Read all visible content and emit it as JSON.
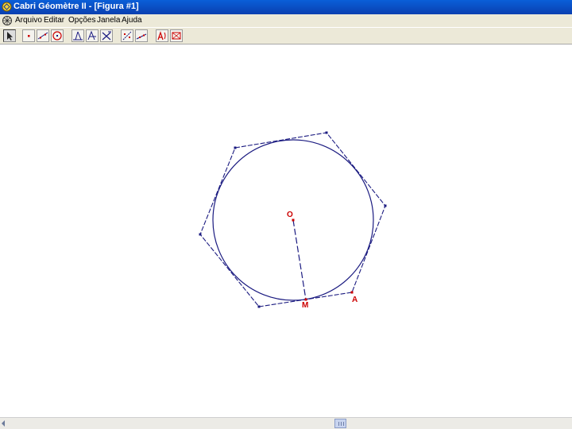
{
  "window": {
    "title": "Cabri Géomètre II - [Figura #1]",
    "icon": "cabri-app-icon"
  },
  "menu": {
    "items": [
      {
        "label": "Arquivo"
      },
      {
        "label": "Editar"
      },
      {
        "label": "Opções"
      },
      {
        "label": "Janela"
      },
      {
        "label": "Ajuda"
      }
    ]
  },
  "toolbar": {
    "tools": [
      {
        "name": "pointer-tool",
        "icon": "arrow-icon",
        "pressed": true
      },
      {
        "name": "point-tool",
        "icon": "point-icon"
      },
      {
        "name": "line-tool",
        "icon": "line-icon"
      },
      {
        "name": "circle-tool",
        "icon": "circle-icon"
      },
      {
        "name": "perpendicular-tool",
        "icon": "perpendicular-icon"
      },
      {
        "name": "transform-tool",
        "icon": "transform-icon"
      },
      {
        "name": "macro-tool",
        "icon": "macro-icon"
      },
      {
        "name": "check-property-tool",
        "icon": "check-property-icon"
      },
      {
        "name": "measure-tool",
        "icon": "measure-icon"
      },
      {
        "name": "label-tool",
        "icon": "label-icon"
      },
      {
        "name": "hide-show-tool",
        "icon": "hide-show-icon"
      }
    ]
  },
  "figure": {
    "points": [
      {
        "id": "O",
        "label": "O"
      },
      {
        "id": "M",
        "label": "M"
      },
      {
        "id": "A",
        "label": "A"
      }
    ],
    "colors": {
      "construction": "#1a1a80",
      "points": "#cc0000"
    }
  }
}
